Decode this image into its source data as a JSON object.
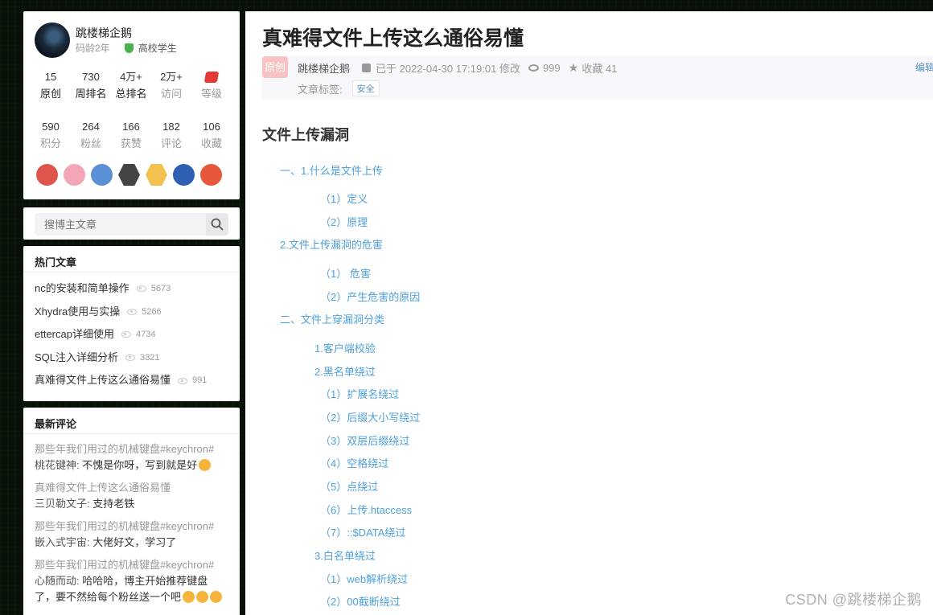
{
  "profile": {
    "name": "跳楼梯企鹅",
    "code_age": "码龄2年",
    "school": "高校学生",
    "stats_row1": [
      {
        "num": "15",
        "label": "原创"
      },
      {
        "num": "730",
        "label": "周排名"
      },
      {
        "num": "4万+",
        "label": "总排名"
      },
      {
        "num": "2万+",
        "label": "访问"
      },
      {
        "num": "",
        "label": "等级"
      }
    ],
    "stats_row2": [
      {
        "num": "590",
        "label": "积分"
      },
      {
        "num": "264",
        "label": "粉丝"
      },
      {
        "num": "166",
        "label": "获赞"
      },
      {
        "num": "182",
        "label": "评论"
      },
      {
        "num": "106",
        "label": "收藏"
      }
    ],
    "badges": [
      "monkey-badge-icon",
      "mascot-badge-icon",
      "laptop-badge-icon",
      "hex-badge-icon",
      "pen-badge-icon",
      "rocket-badge-icon",
      "gift-badge-icon"
    ]
  },
  "search": {
    "placeholder": "搜博主文章"
  },
  "hot": {
    "title": "热门文章",
    "items": [
      {
        "title": "nc的安装和简单操作",
        "views": "5673"
      },
      {
        "title": "Xhydra使用与实操",
        "views": "5266"
      },
      {
        "title": "ettercap详细使用",
        "views": "4734"
      },
      {
        "title": "SQL注入详细分析",
        "views": "3321"
      },
      {
        "title": "真难得文件上传这么通俗易懂",
        "views": "991"
      }
    ]
  },
  "comments": {
    "title": "最新评论",
    "items": [
      {
        "source": "那些年我们用过的机械键盘#keychron#",
        "user": "桃花键神:",
        "text": " 不愧是你呀，写到就是好"
      },
      {
        "source": "真难得文件上传这么通俗易懂",
        "user": "三贝勒文子:",
        "text": " 支持老铁"
      },
      {
        "source": "那些年我们用过的机械键盘#keychron#",
        "user": "嵌入式宇宙:",
        "text": " 大佬好文，学习了"
      },
      {
        "source": "那些年我们用过的机械键盘#keychron#",
        "user": "心随而动:",
        "text": " 哈哈哈，博主开始推荐键盘了，要不然给每个粉丝送一个吧"
      }
    ]
  },
  "article": {
    "title": "真难得文件上传这么通俗易懂",
    "original_tag": "原创",
    "author": "跳楼梯企鹅",
    "modified": "已于 2022-04-30 17:19:01 修改",
    "views": "999",
    "favorites": "收藏 41",
    "edit": "编辑",
    "tags_label": "文章标签:",
    "tag": "安全",
    "toc_heading": "文件上传漏洞",
    "toc": [
      "一、1.什么是文件上传",
      "（1）定义",
      "（2）原理",
      "2.文件上传漏洞的危害",
      "（1） 危害",
      "（2）产生危害的原因",
      "二、文件上穿漏洞分类",
      "1.客户端校验",
      "2.黑名单绕过",
      "（1）扩展名绕过",
      "（2）后缀大小写绕过",
      "（3）双层后缀绕过",
      "（4）空格绕过",
      "（5）点绕过",
      "（6）上传.htaccess",
      "（7）::$DATA绕过",
      "3.白名单绕过",
      "（1）web解析绕过",
      "（2）00截断绕过"
    ]
  },
  "watermark": "CSDN @跳楼梯企鹅"
}
